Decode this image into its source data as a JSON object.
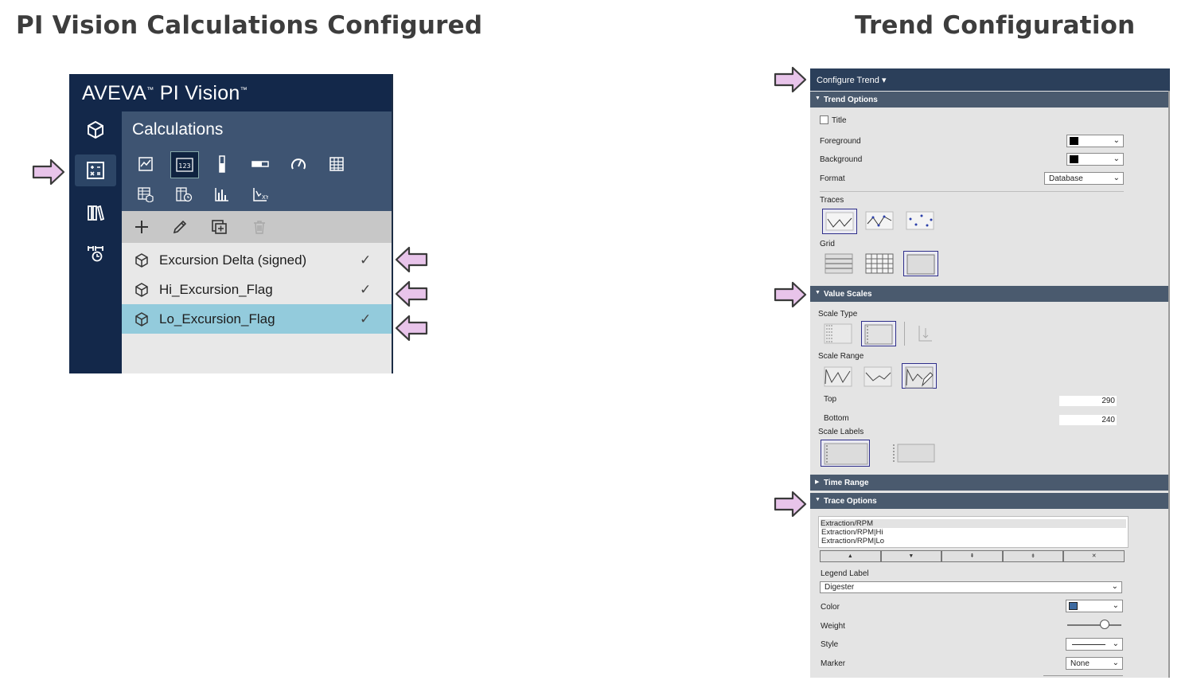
{
  "headings": {
    "left": "PI Vision Calculations Configured",
    "right": "Trend Configuration"
  },
  "pivision": {
    "brand": "AVEVA",
    "product": "PI Vision",
    "tm": "™",
    "section_title": "Calculations",
    "calculations": [
      {
        "name": "Excursion Delta (signed)",
        "check": "✓",
        "selected": false
      },
      {
        "name": "Hi_Excursion_Flag",
        "check": "✓",
        "selected": false
      },
      {
        "name": "Lo_Excursion_Flag",
        "check": "✓",
        "selected": true
      }
    ],
    "symbol_icons": [
      "trend-icon",
      "value-icon",
      "vertical-gauge-icon",
      "horizontal-gauge-icon",
      "radial-gauge-icon",
      "table-icon",
      "asset-comparison-table-icon",
      "event-table-icon",
      "bar-chart-icon",
      "xy-plot-icon"
    ],
    "rail_icons": [
      "assets-icon",
      "calculations-icon",
      "library-icon",
      "events-icon"
    ],
    "colors": {
      "navy": "#13284a",
      "selected_row": "#93cbdc"
    }
  },
  "trend": {
    "configure_title": "Configure Trend",
    "sections": {
      "trend_options": "Trend Options",
      "value_scales": "Value Scales",
      "time_range": "Time Range",
      "trace_options": "Trace Options"
    },
    "labels": {
      "title": "Title",
      "foreground": "Foreground",
      "background": "Background",
      "format": "Format",
      "traces": "Traces",
      "grid": "Grid",
      "scale_type": "Scale Type",
      "scale_range": "Scale Range",
      "top": "Top",
      "bottom": "Bottom",
      "scale_labels": "Scale Labels",
      "legend_label": "Legend Label",
      "color": "Color",
      "weight": "Weight",
      "style": "Style",
      "marker": "Marker"
    },
    "values": {
      "format": "Database",
      "top": "290",
      "bottom": "240",
      "legend_label": "Digester",
      "marker": "None"
    },
    "trace_list": [
      "Extraction/RPM",
      "Extraction/RPM|Hi",
      "Extraction/RPM|Lo"
    ],
    "trace_buttons": [
      "▲",
      "▼",
      "⇞",
      "⇟",
      "✕"
    ],
    "colors": {
      "header": "#2b3f5a",
      "section": "#4a5a6e",
      "trace_color": "#3d6aa0"
    }
  },
  "arrows_color": "#e8bde8"
}
